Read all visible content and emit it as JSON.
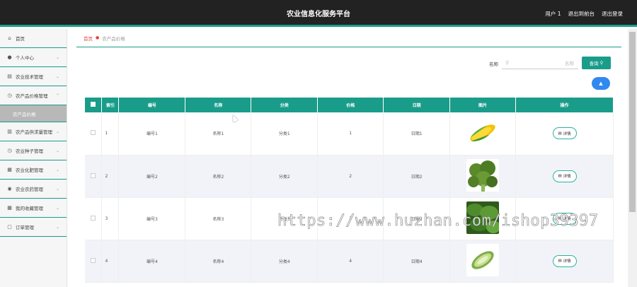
{
  "header": {
    "title": "农业信息化服务平台",
    "user_label": "用户 1",
    "switch_label": "退出到前台",
    "logout_label": "退出登录"
  },
  "sidebar": {
    "items": [
      {
        "label": "首页",
        "icon": "home-icon",
        "glyph": "⌂"
      },
      {
        "label": "个人中心",
        "icon": "user-icon",
        "glyph": "●"
      },
      {
        "label": "农业技术管理",
        "icon": "calendar-icon",
        "glyph": "▤"
      },
      {
        "label": "农产品价格管理",
        "icon": "clock-icon",
        "glyph": "◷"
      },
      {
        "label": "农产品价格",
        "submenu": true
      },
      {
        "label": "农产品供求量管理",
        "icon": "list-icon",
        "glyph": "▥"
      },
      {
        "label": "农业种子管理",
        "icon": "clock-icon",
        "glyph": "◷"
      },
      {
        "label": "农业化肥管理",
        "icon": "box-icon",
        "glyph": "▦"
      },
      {
        "label": "农业农药管理",
        "icon": "pin-icon",
        "glyph": "◉"
      },
      {
        "label": "我的收藏管理",
        "icon": "grid-icon",
        "glyph": "▦"
      },
      {
        "label": "订单管理",
        "icon": "order-icon",
        "glyph": "▢"
      }
    ]
  },
  "breadcrumb": {
    "home": "首页",
    "current": "农产品价格"
  },
  "search": {
    "label": "名称",
    "placeholder": "名称",
    "button": "查询"
  },
  "table": {
    "headers": [
      "索引",
      "编号",
      "名称",
      "分类",
      "价格",
      "日期",
      "图片",
      "操作"
    ],
    "rows": [
      {
        "index": "1",
        "code": "编号1",
        "name": "名称1",
        "category": "分类1",
        "price": "1",
        "date": "日期1",
        "image": "corn",
        "action": "详情"
      },
      {
        "index": "2",
        "code": "编号2",
        "name": "名称2",
        "category": "分类2",
        "price": "2",
        "date": "日期2",
        "image": "broccoli",
        "action": "详情"
      },
      {
        "index": "3",
        "code": "编号3",
        "name": "名称3",
        "category": "分类3",
        "price": "3",
        "date": "日期3",
        "image": "greens",
        "action": "详情"
      },
      {
        "index": "4",
        "code": "编号4",
        "name": "名称4",
        "category": "分类4",
        "price": "4",
        "date": "日期4",
        "image": "melon",
        "action": "详情"
      }
    ]
  },
  "watermark": "https://www.huzhan.com/ishop39397",
  "colors": {
    "accent": "#1a9c8a",
    "header_bg": "#222222",
    "blue": "#2f89f0",
    "breadcrumb_red": "#e0453d"
  }
}
